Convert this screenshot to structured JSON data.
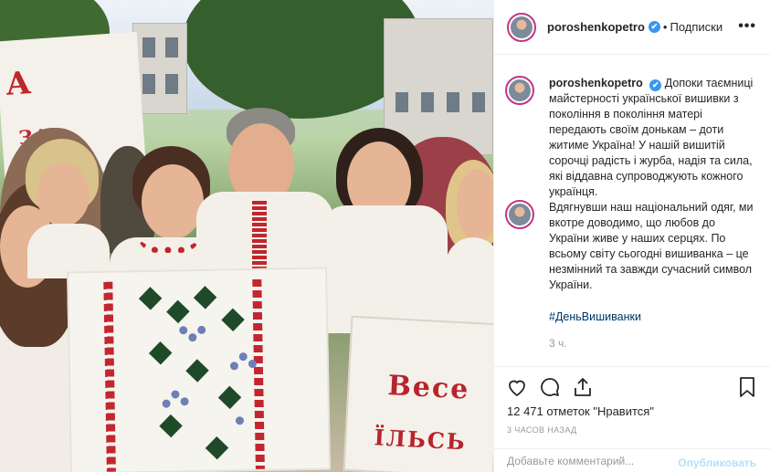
{
  "post": {
    "username": "poroshenkopetro",
    "verified_mark": "✔",
    "separator": "•",
    "follow_label": "Подписки",
    "more_label": "•••",
    "caption": "Допоки таємниці майстерності української вишивки з покоління в покоління матері передають своїм донькам – доти житиме Україна! У нашій вишитій сорочці радість і журба, надія та сила, які віддавна супроводжують кожного українця.",
    "reply": "Вдягнувши наш національний одяг, ми вкотре доводимо, що любов до України живе у наших серцях. По всьому світу сьогодні вишиванка – це незмінний та завжди сучасний символ України.",
    "hashtag": "#ДеньВишиванки",
    "time": "3 ч.",
    "likes": "12 471 отметок \"Нравится\"",
    "ago": "3 ЧАСОВ НАЗАД",
    "comment_placeholder": "Добавьте комментарий...",
    "publish_label": "Опубликовать"
  },
  "photo": {
    "banner_left": [
      "А",
      "ЗА"
    ],
    "banner_right": [
      "Весе",
      "ЇЛЬСЬ"
    ]
  },
  "icons": {
    "like": "heart-icon",
    "comment": "comment-icon",
    "share": "share-icon",
    "save": "bookmark-icon",
    "more": "more-icon"
  },
  "colors": {
    "link": "#003569",
    "verified": "#3897f0",
    "publish_disabled": "#b2dffc",
    "muted": "#999999"
  }
}
